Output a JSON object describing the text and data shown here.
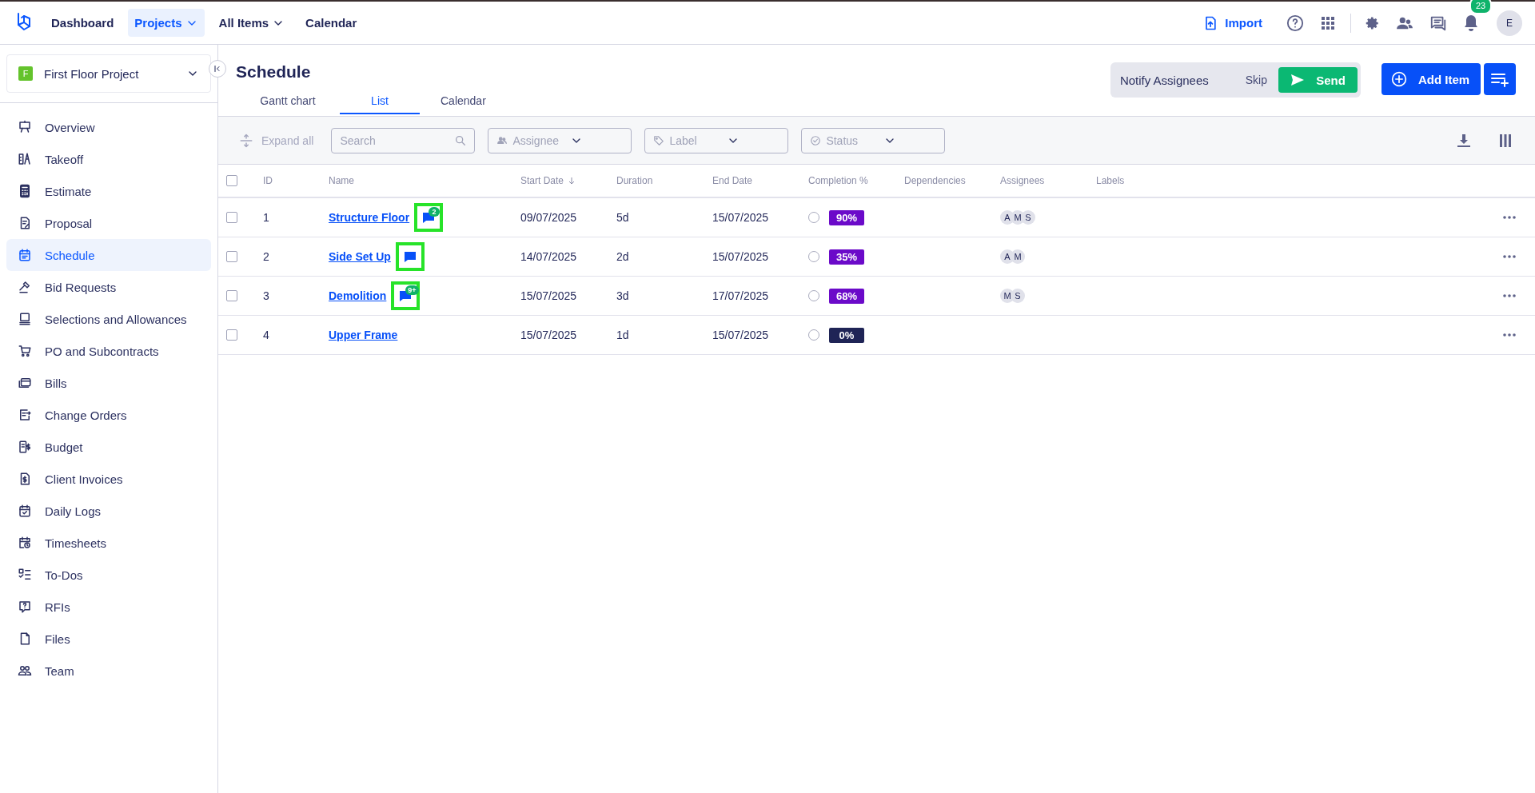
{
  "top_nav": {
    "items": [
      {
        "label": "Dashboard",
        "selected": false,
        "dropdown": false
      },
      {
        "label": "Projects",
        "selected": true,
        "dropdown": true
      },
      {
        "label": "All Items",
        "selected": false,
        "dropdown": true
      },
      {
        "label": "Calendar",
        "selected": false,
        "dropdown": false
      }
    ],
    "import_label": "Import",
    "notification_count": "23",
    "avatar_initial": "E"
  },
  "project_selector": {
    "badge": "F",
    "name": "First Floor Project"
  },
  "sidebar": {
    "items": [
      {
        "label": "Overview",
        "selected": false
      },
      {
        "label": "Takeoff",
        "selected": false
      },
      {
        "label": "Estimate",
        "selected": false
      },
      {
        "label": "Proposal",
        "selected": false
      },
      {
        "label": "Schedule",
        "selected": true
      },
      {
        "label": "Bid Requests",
        "selected": false
      },
      {
        "label": "Selections and Allowances",
        "selected": false
      },
      {
        "label": "PO and Subcontracts",
        "selected": false
      },
      {
        "label": "Bills",
        "selected": false
      },
      {
        "label": "Change Orders",
        "selected": false
      },
      {
        "label": "Budget",
        "selected": false
      },
      {
        "label": "Client Invoices",
        "selected": false
      },
      {
        "label": "Daily Logs",
        "selected": false
      },
      {
        "label": "Timesheets",
        "selected": false
      },
      {
        "label": "To-Dos",
        "selected": false
      },
      {
        "label": "RFIs",
        "selected": false
      },
      {
        "label": "Files",
        "selected": false
      },
      {
        "label": "Team",
        "selected": false
      }
    ]
  },
  "page": {
    "title": "Schedule",
    "tabs": [
      {
        "label": "Gantt chart",
        "selected": false
      },
      {
        "label": "List",
        "selected": true
      },
      {
        "label": "Calendar",
        "selected": false
      }
    ],
    "notify": {
      "label": "Notify Assignees",
      "skip": "Skip",
      "send": "Send"
    },
    "add_item": "Add Item"
  },
  "toolbar": {
    "expand_all": "Expand all",
    "search": {
      "placeholder": "Search"
    },
    "filters": [
      {
        "placeholder": "Assignee"
      },
      {
        "placeholder": "Label"
      },
      {
        "placeholder": "Status"
      }
    ]
  },
  "table": {
    "all_checked": false,
    "columns": [
      {
        "label": "ID",
        "sorted": false
      },
      {
        "label": "Name",
        "sorted": false
      },
      {
        "label": "Start Date",
        "sorted": true
      },
      {
        "label": "Duration",
        "sorted": false
      },
      {
        "label": "End Date",
        "sorted": false
      },
      {
        "label": "Completion %",
        "sorted": false
      },
      {
        "label": "Dependencies",
        "sorted": false
      },
      {
        "label": "Assignees",
        "sorted": false
      },
      {
        "label": "Labels",
        "sorted": false
      }
    ],
    "rows": [
      {
        "checked": false,
        "id": "1",
        "name": "Structure Floor",
        "comment": {
          "count": "2",
          "highlighted": true
        },
        "start": "09/07/2025",
        "duration": "5d",
        "end": "15/07/2025",
        "done": false,
        "completion": {
          "text": "90%",
          "color": "#6b0ac9"
        },
        "assignees": [
          "A",
          "M",
          "S"
        ]
      },
      {
        "checked": false,
        "id": "2",
        "name": "Side Set Up",
        "comment": {
          "highlighted": true
        },
        "start": "14/07/2025",
        "duration": "2d",
        "end": "15/07/2025",
        "done": false,
        "completion": {
          "text": "35%",
          "color": "#6b0ac9"
        },
        "assignees": [
          "A",
          "M"
        ]
      },
      {
        "checked": false,
        "id": "3",
        "name": "Demolition",
        "comment": {
          "count": "9+",
          "highlighted": true
        },
        "start": "15/07/2025",
        "duration": "3d",
        "end": "17/07/2025",
        "done": false,
        "completion": {
          "text": "68%",
          "color": "#6b0ac9"
        },
        "assignees": [
          "M",
          "S"
        ]
      },
      {
        "checked": false,
        "id": "4",
        "name": "Upper Frame",
        "start": "15/07/2025",
        "duration": "1d",
        "end": "15/07/2025",
        "done": false,
        "completion": {
          "text": "0%",
          "color": "#1f2456"
        },
        "assignees": []
      }
    ]
  }
}
